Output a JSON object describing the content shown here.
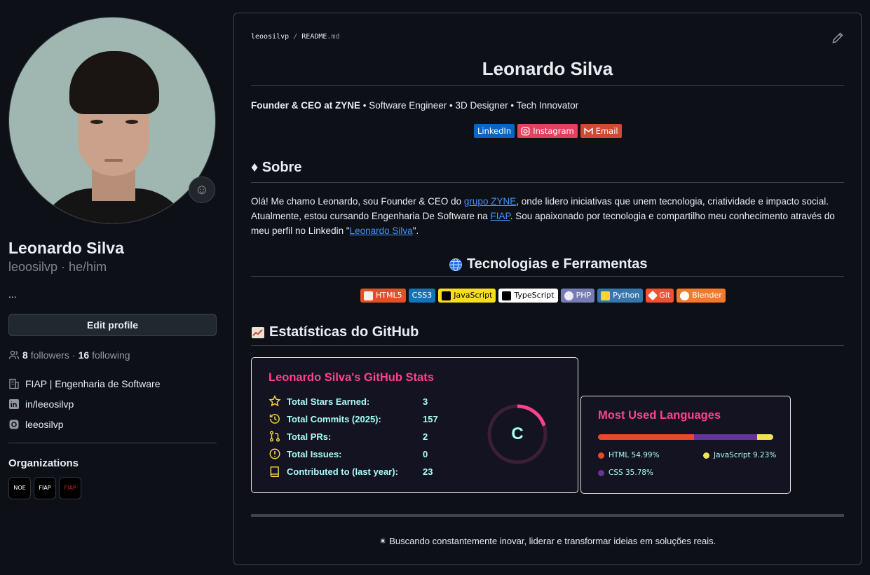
{
  "profile": {
    "name": "Leonardo Silva",
    "login_pronouns": "leoosilvp · he/him",
    "bio": "...",
    "edit_label": "Edit profile",
    "followers_count": "8",
    "followers_label": "followers",
    "sep": "·",
    "following_count": "16",
    "following_label": "following",
    "org_line": "FIAP | Engenharia de Software",
    "linkedin": "in/leeosilvp",
    "instagram": "leeosilvp",
    "organizations_title": "Organizations",
    "orgs": [
      "NOE",
      "FIAP",
      "FIAP"
    ]
  },
  "readme": {
    "crumb_user": "leoosilvp",
    "crumb_sep": "/",
    "crumb_file": "README",
    "crumb_ext": ".md",
    "title": "Leonardo Silva",
    "tagline_bold": "Founder & CEO at ZYNE",
    "tagline_rest": " • Software Engineer • 3D Designer • Tech Innovator",
    "social_badges": [
      {
        "label": "LinkedIn",
        "color": "#0a66c2",
        "icon": "linkedin-icon"
      },
      {
        "label": "Instagram",
        "color": "#e4405f",
        "icon": "instagram-icon"
      },
      {
        "label": "Email",
        "color": "#d14836",
        "icon": "gmail-icon"
      }
    ],
    "about_heading": "♦ Sobre",
    "about_p1": "Olá! Me chamo Leonardo, sou Founder & CEO do ",
    "about_link1": "grupo ZYNE",
    "about_p2": ", onde lidero iniciativas que unem tecnologia, criatividade e impacto social. Atualmente, estou cursando Engenharia De Software na ",
    "about_link2": "FIAP",
    "about_p3": ". Sou apaixonado por tecnologia e compartilho meu conhecimento através do meu perfil no Linkedin \"",
    "about_link3": "Leonardo Silva",
    "about_p4": "\".",
    "tech_heading": "Tecnologias e Ferramentas",
    "tech_badges": [
      {
        "label": "HTML5",
        "bg": "#e34f26",
        "fg": "#ffffff"
      },
      {
        "label": "CSS3",
        "bg": "#1572b6",
        "fg": "#ffffff"
      },
      {
        "label": "JavaScript",
        "bg": "#f7df1e",
        "fg": "#000000"
      },
      {
        "label": "TypeScript",
        "bg": "#ffffff",
        "fg": "#000000"
      },
      {
        "label": "PHP",
        "bg": "#777bb4",
        "fg": "#ffffff"
      },
      {
        "label": "Python",
        "bg": "#3776ab",
        "fg": "#ffffff"
      },
      {
        "label": "Git",
        "bg": "#f05033",
        "fg": "#ffffff"
      },
      {
        "label": "Blender",
        "bg": "#f5792a",
        "fg": "#ffffff"
      }
    ],
    "stats_heading": "Estatísticas do GitHub",
    "stats": {
      "title": "Leonardo Silva's GitHub Stats",
      "rows": [
        {
          "label": "Total Stars Earned:",
          "value": "3",
          "icon": "star-icon"
        },
        {
          "label": "Total Commits (2025):",
          "value": "157",
          "icon": "history-icon"
        },
        {
          "label": "Total PRs:",
          "value": "2",
          "icon": "pull-request-icon"
        },
        {
          "label": "Total Issues:",
          "value": "0",
          "icon": "issue-icon"
        },
        {
          "label": "Contributed to (last year):",
          "value": "23",
          "icon": "repo-icon"
        }
      ],
      "grade": "C",
      "grade_progress": 0.2
    },
    "languages": {
      "title": "Most Used Languages",
      "items": [
        {
          "name": "HTML",
          "percent": 54.99,
          "label": "HTML 54.99%",
          "color": "#e34c26"
        },
        {
          "name": "CSS",
          "percent": 35.78,
          "label": "CSS 35.78%",
          "color": "#663399"
        },
        {
          "name": "JavaScript",
          "percent": 9.23,
          "label": "JavaScript 9.23%",
          "color": "#f1e05a"
        }
      ]
    },
    "footer": "✴ Buscando constantemente inovar, liderar e transformar ideias em soluções reais."
  },
  "colors": {
    "accent_pink": "#fe428e",
    "accent_cyan": "#a9fef7",
    "icon_yellow": "#f8d847",
    "link_blue": "#4493f8"
  }
}
